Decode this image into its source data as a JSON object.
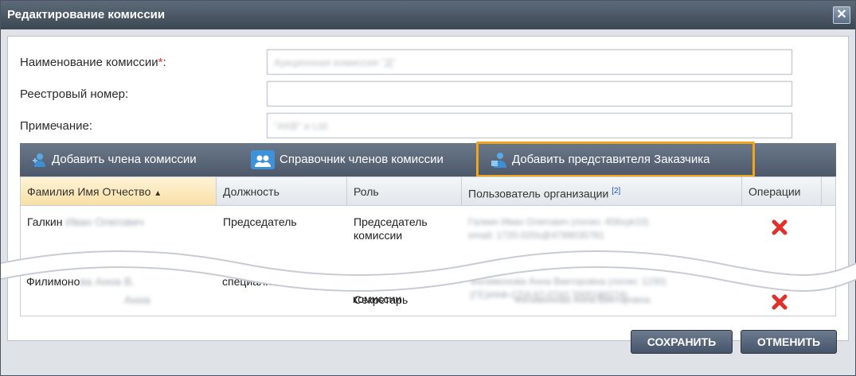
{
  "window": {
    "title": "Редактирование комиссии"
  },
  "form": {
    "name_label": "Наименование комиссии",
    "name_required_mark": "*",
    "name_colon": ":",
    "name_value": "Аукционная комиссия \"Д\"",
    "registry_label": "Реестровый номер:",
    "registry_value": "",
    "note_label": "Примечание:",
    "note_value": "\"АКВ\" и Ltd"
  },
  "toolbar": {
    "add_member": "Добавить члена комиссии",
    "members_directory": "Справочник членов комиссии",
    "add_customer_rep": "Добавить представителя Заказчика"
  },
  "table": {
    "columns": [
      "Фамилия Имя Отчество",
      "Должность",
      "Роль",
      "Пользователь организации",
      "Операции"
    ],
    "user_col_ref": "[2]",
    "rows": [
      {
        "fio": "Галкин",
        "fio_hidden": "Иван Олегович",
        "position": "Председатель",
        "role_1": "Председатель",
        "role_2": "комиссии",
        "user_1": "Галкин Иван Олегович (логин: 456xyk10)",
        "user_2": "email: 1720-020s@4789035761"
      },
      {
        "fio": "",
        "fio_hidden": "Анна",
        "position": "",
        "role_1": "Секретарь",
        "role_2": "",
        "user_1": "Филимонова Анна Викторовна",
        "user_2": ""
      },
      {
        "fio": "Филимоно",
        "fio_hidden": "ва Анна В.",
        "position": "специалист за",
        "role_1": "",
        "role_2": "комиссии",
        "user_1": "Филимонова Анна Викторовна (логин: 1230)",
        "user_2": "(ГЕ)ИАФ-СТИ-67-0743 7005189274)"
      }
    ]
  },
  "footer": {
    "save": "СОХРАНИТЬ",
    "cancel": "ОТМЕНИТЬ"
  },
  "colors": {
    "accent_highlight": "#f0a51d",
    "delete_red": "#e0322b"
  }
}
